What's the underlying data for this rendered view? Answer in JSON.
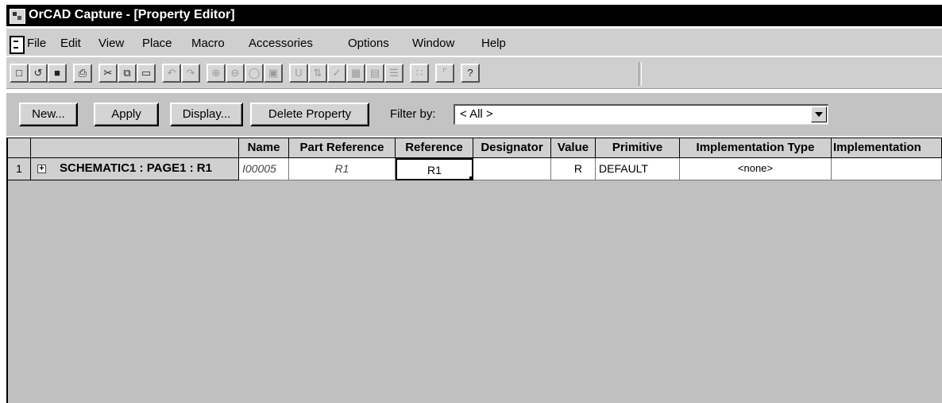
{
  "window": {
    "title": "OrCAD Capture - [Property Editor]"
  },
  "menu": {
    "items": [
      {
        "label": "File"
      },
      {
        "label": "Edit"
      },
      {
        "label": "View"
      },
      {
        "label": "Place"
      },
      {
        "label": "Macro"
      },
      {
        "label": "Accessories"
      },
      {
        "label": "Options"
      },
      {
        "label": "Window"
      },
      {
        "label": "Help"
      }
    ]
  },
  "toolbar": {
    "buttons": [
      "new-icon",
      "open-icon",
      "save-icon",
      "print-icon",
      "cut-icon",
      "copy-icon",
      "paste-icon",
      "undo-icon",
      "redo-icon",
      "zoom-in-icon",
      "zoom-out-icon",
      "zoom-area-icon",
      "zoom-all-icon",
      "annotate-icon",
      "back-annotate-icon",
      "drc-icon",
      "netlist-icon",
      "cross-reference-icon",
      "bill-of-materials-icon",
      "snap-to-grid-icon",
      "area-select-icon",
      "help-icon"
    ]
  },
  "filterbar": {
    "new_label": "New...",
    "apply_label": "Apply",
    "display_label": "Display...",
    "delete_label": "Delete Property",
    "filter_label": "Filter by:",
    "filter_value": "< All >"
  },
  "grid": {
    "columns": [
      "Name",
      "Part Reference",
      "Reference",
      "Designator",
      "Value",
      "Primitive",
      "Implementation Type",
      "Implementation"
    ],
    "rows": [
      {
        "number": "1",
        "header": "SCHEMATIC1 : PAGE1 : R1",
        "cells": [
          "I00005",
          "R1",
          "R1",
          "",
          "R",
          "DEFAULT",
          "<none>",
          ""
        ]
      }
    ]
  }
}
